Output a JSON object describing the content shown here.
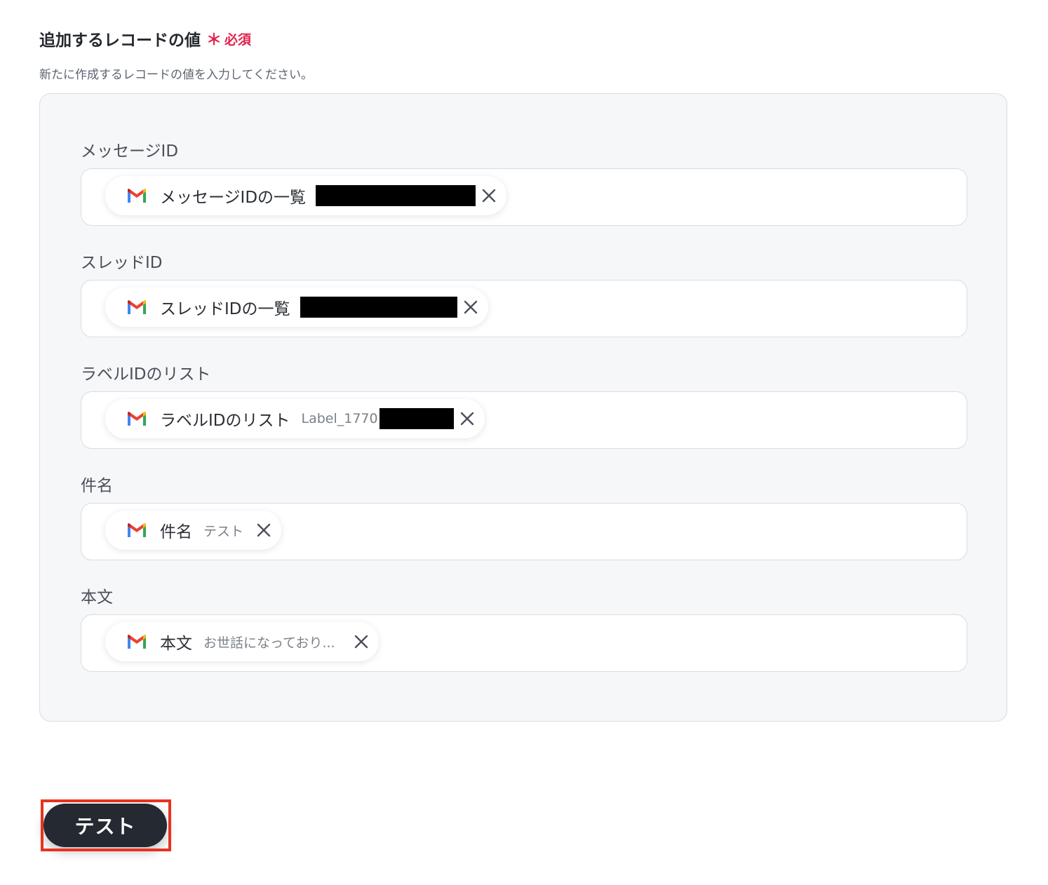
{
  "section": {
    "title": "追加するレコードの値",
    "required_star": "＊",
    "required_label": "必須",
    "description": "新たに作成するレコードの値を入力してください。",
    "required_color": "#e0244d"
  },
  "fields": [
    {
      "label": "メッセージID",
      "chip": {
        "icon": "gmail-icon",
        "name": "メッセージIDの一覧",
        "value": "",
        "redacted": true
      }
    },
    {
      "label": "スレッドID",
      "chip": {
        "icon": "gmail-icon",
        "name": "スレッドIDの一覧",
        "value": "",
        "redacted": true
      }
    },
    {
      "label": "ラベルIDのリスト",
      "chip": {
        "icon": "gmail-icon",
        "name": "ラベルIDのリスト",
        "value": "Label_1770",
        "redacted": true
      }
    },
    {
      "label": "件名",
      "chip": {
        "icon": "gmail-icon",
        "name": "件名",
        "value": "テスト",
        "redacted": false
      }
    },
    {
      "label": "本文",
      "chip": {
        "icon": "gmail-icon",
        "name": "本文",
        "value": "お世話になっており...",
        "redacted": false
      }
    }
  ],
  "actions": {
    "test_label": "テスト",
    "button_color": "#242932",
    "highlight_color": "#e8321f"
  }
}
